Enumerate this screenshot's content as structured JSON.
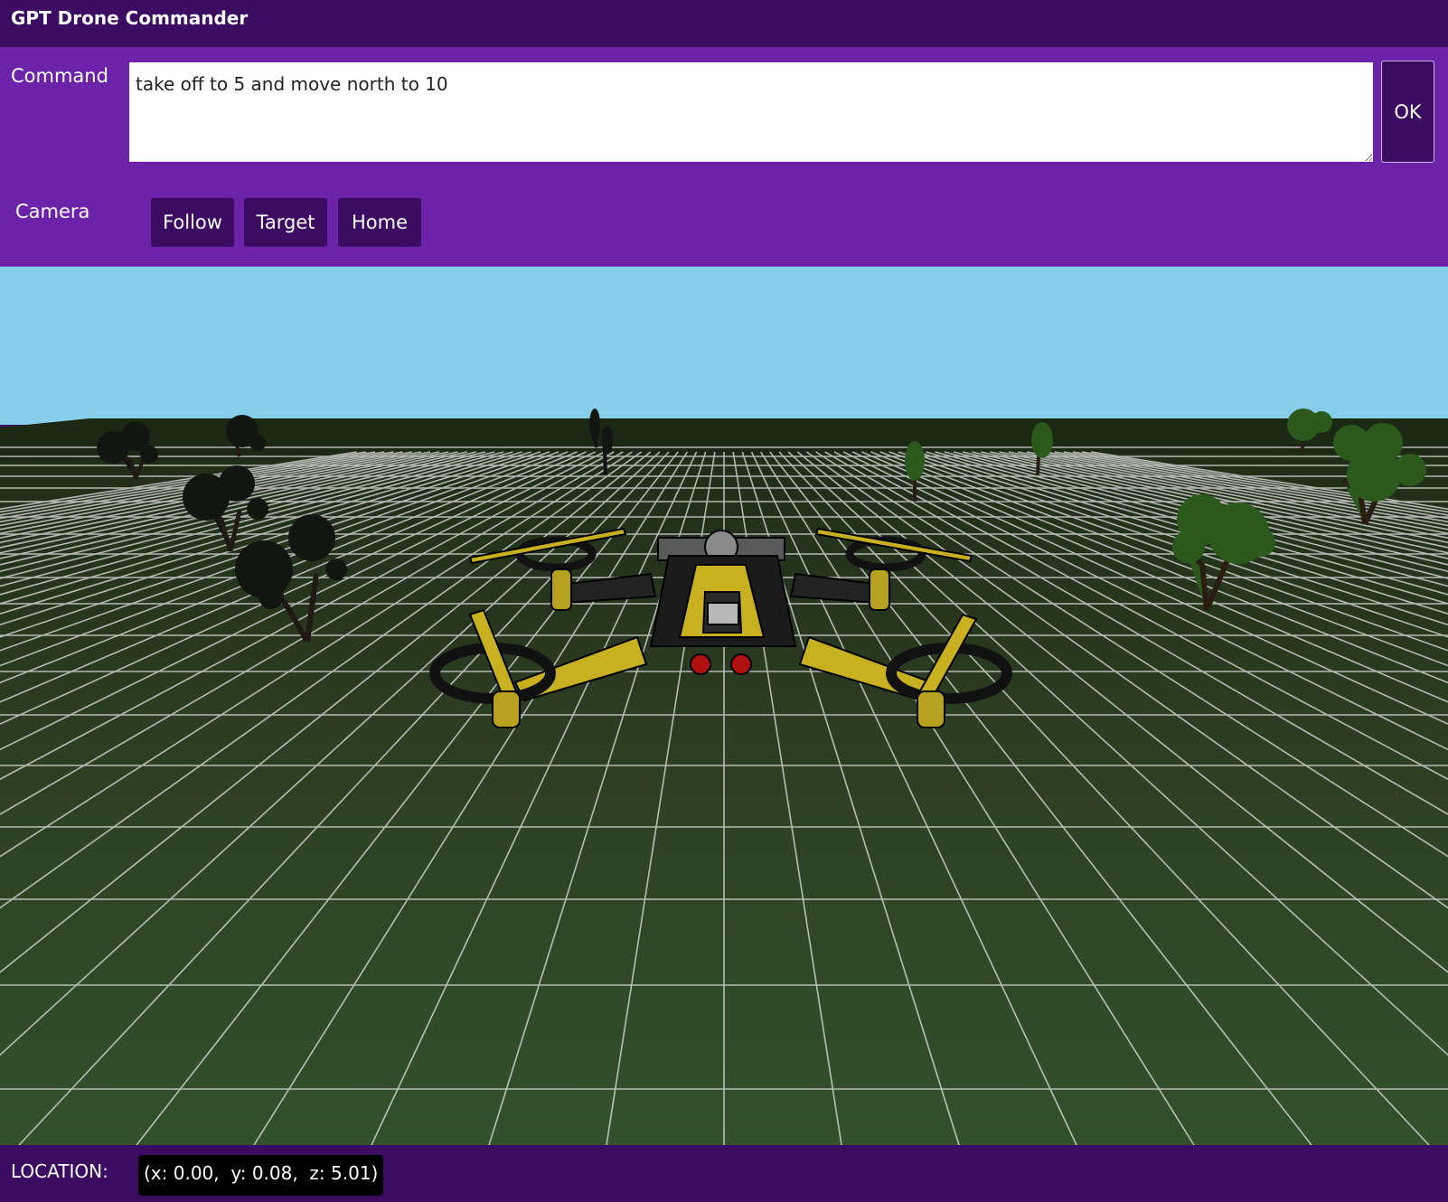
{
  "app": {
    "title": "GPT Drone Commander"
  },
  "command": {
    "label": "Command",
    "value": "take off to 5 and move north to 10",
    "ok_label": "OK"
  },
  "camera": {
    "label": "Camera",
    "buttons": [
      "Follow",
      "Target",
      "Home"
    ]
  },
  "location": {
    "label": "LOCATION:",
    "value": "(x: 0.00,  y: 0.08,  z: 5.01)"
  },
  "scene": {
    "sky_color": "#87ceeb",
    "ground_color": "#2d4024",
    "grid_color": "#e6e6e6",
    "drone_accent": "#c8b020"
  }
}
